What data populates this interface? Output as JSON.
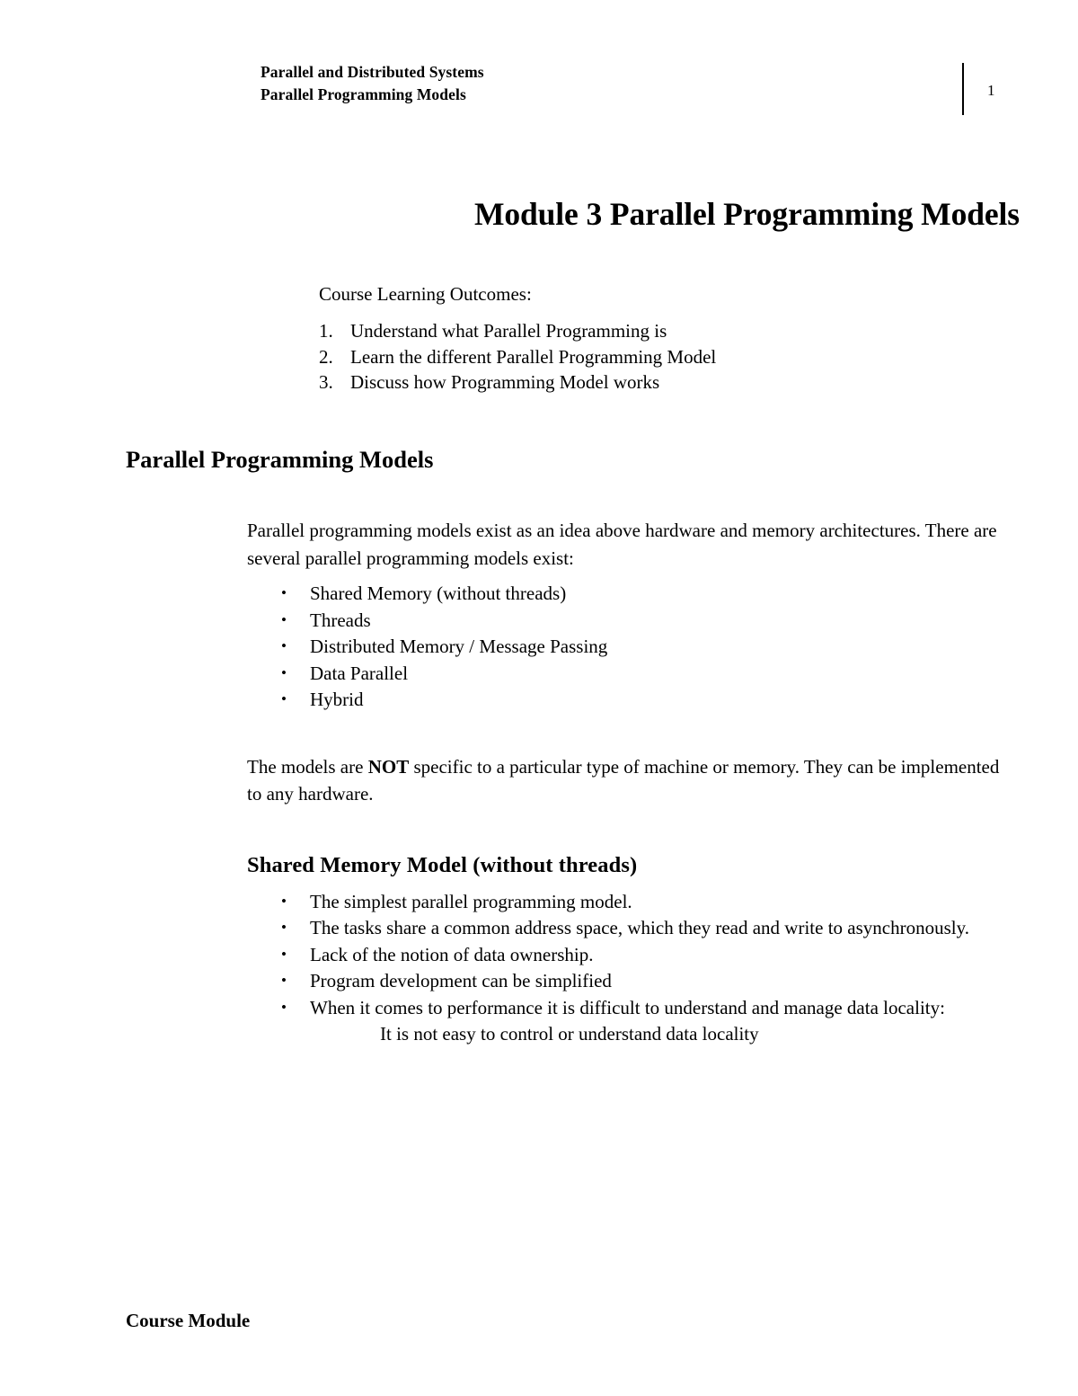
{
  "header": {
    "line1": "Parallel and Distributed Systems",
    "line2": "Parallel Programming Models",
    "page_number": "1"
  },
  "title": "Module 3 Parallel Programming Models",
  "learning_outcomes": {
    "label": "Course Learning Outcomes:",
    "items": [
      {
        "number": "1.",
        "text": "Understand what Parallel Programming is"
      },
      {
        "number": "2.",
        "text": "Learn the different Parallel Programming Model"
      },
      {
        "number": "3.",
        "text": "Discuss how Programming Model works"
      }
    ]
  },
  "section": {
    "heading": "Parallel Programming Models",
    "intro_paragraph": "Parallel programming models exist as an idea above hardware and memory architectures. There are several parallel programming models exist:",
    "models": [
      "Shared Memory (without threads)",
      "Threads",
      "Distributed Memory / Message Passing",
      "Data Parallel",
      "Hybrid"
    ],
    "note_before_bold": "The models are ",
    "note_bold": "NOT",
    "note_after_bold": " specific to a particular type of machine or memory. They can be implemented to any hardware."
  },
  "shared_memory": {
    "heading": "Shared Memory Model (without threads)",
    "bullets": [
      "The simplest parallel programming model.",
      "The tasks share a common address space, which they read and write to asynchronously.",
      "Lack of the notion of data ownership.",
      "Program development can be simplified",
      "When it comes to performance it is difficult to understand and manage data locality:"
    ],
    "sub_note": "It is not easy to control or understand data locality"
  },
  "footer": {
    "label": "Course Module"
  },
  "bullet_glyph": "•"
}
